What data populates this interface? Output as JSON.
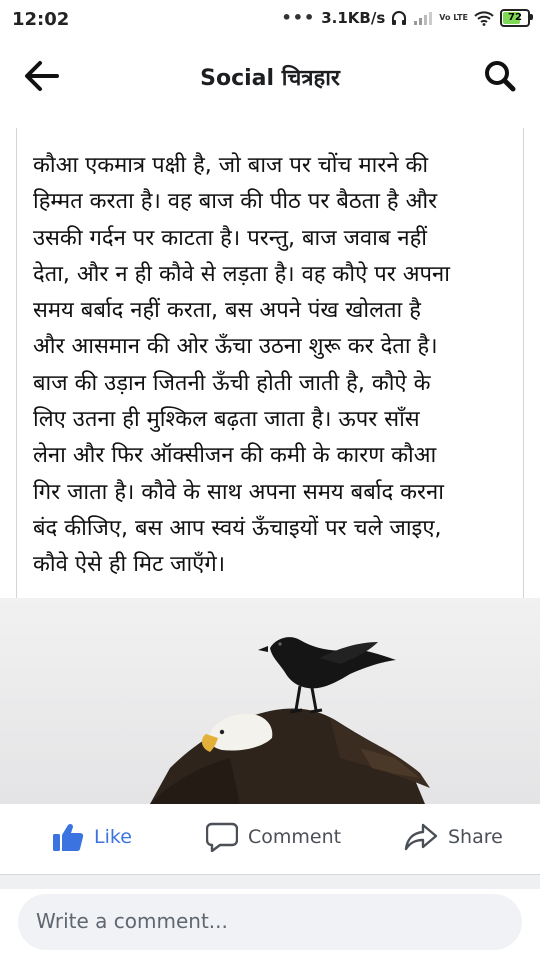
{
  "status_bar": {
    "time": "12:02",
    "dots": "•••",
    "network_speed": "3.1KB/s",
    "volte": "Vo LTE",
    "battery": "72",
    "battery_level": 0.72
  },
  "header": {
    "title": "Social चित्रहार",
    "back_icon": "back-arrow-icon",
    "search_icon": "search-icon"
  },
  "post": {
    "text_lines": [
      "कौआ एकमात्र पक्षी है, जो बाज पर चोंच मारने की",
      "हिम्मत करता है। वह बाज की पीठ पर बैठता है और",
      "उसकी गर्दन पर काटता है। परन्तु, बाज जवाब नहीं",
      "देता, और न ही कौवे से लड़ता है। वह कौऐ पर अपना",
      "समय बर्बाद नहीं करता, बस अपने पंख खोलता है",
      "और आसमान की ओर ऊँचा उठना शुरू कर देता है।",
      "बाज की उड़ान जितनी ऊँची होती जाती है, कौऐ के",
      "लिए उतना ही मुश्किल बढ़ता जाता है। ऊपर साँस",
      "लेना और फिर ऑक्सीजन की कमी के कारण कौआ",
      "गिर जाता है। कौवे के साथ अपना समय बर्बाद करना",
      "बंद कीजिए, बस आप स्वयं ऊँचाइयों पर चले जाइए,",
      "कौवे ऐसे ही मिट जाएँगे।"
    ],
    "image_description_icons": [
      "crow-icon",
      "eagle-icon"
    ]
  },
  "actions": {
    "like": "Like",
    "comment": "Comment",
    "share": "Share"
  },
  "comment_box": {
    "placeholder": "Write a comment..."
  },
  "colors": {
    "accent": "#3b74e0",
    "text": "#111111",
    "muted": "#606770"
  }
}
